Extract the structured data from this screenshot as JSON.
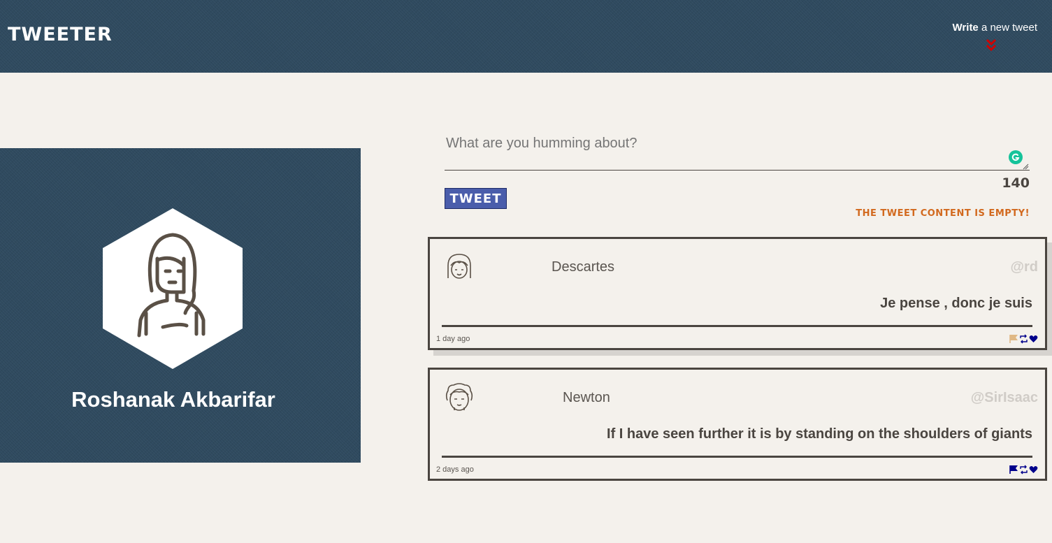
{
  "app": {
    "brand": "TWEETER"
  },
  "nav": {
    "compose_strong": "Write",
    "compose_rest": " a new tweet"
  },
  "profile": {
    "name": "Roshanak Akbarifar"
  },
  "composer": {
    "placeholder": "What are you humming about?",
    "counter": "140",
    "button_label": "Tweet",
    "error": "The tweet content is empty!"
  },
  "tweets": [
    {
      "name": "Descartes",
      "handle": "@rd",
      "text": "Je pense , donc je suis",
      "time": "1 day ago",
      "flag_color": "#e0b884"
    },
    {
      "name": "Newton",
      "handle": "@SirIsaac",
      "text": "If I have seen further it is by standing on the shoulders of giants",
      "time": "2 days ago",
      "flag_color": "#00008b"
    }
  ],
  "colors": {
    "denim": "#2f4a5f",
    "page_bg": "#f4f1ec",
    "text": "#4a4540",
    "button": "#4a5dab",
    "error": "#d2691e",
    "chevron": "#d10000",
    "action_icons": "#00008b"
  },
  "icons": [
    "double-chevron-down-icon",
    "grammarly-icon",
    "flag-icon",
    "retweet-icon",
    "heart-icon"
  ]
}
